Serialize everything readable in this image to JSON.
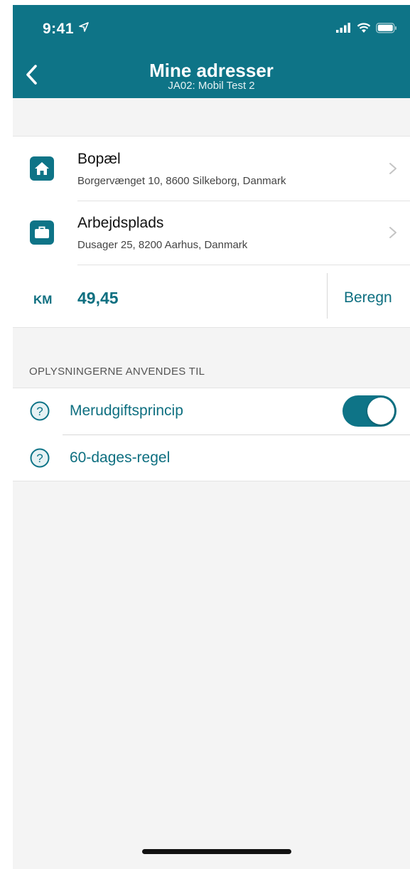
{
  "status_bar": {
    "time": "9:41"
  },
  "nav": {
    "title": "Mine adresser",
    "subtitle": "JA02: Mobil Test 2"
  },
  "addresses": [
    {
      "title": "Bopæl",
      "address": "Borgervænget 10, 8600 Silkeborg, Danmark",
      "icon": "home-icon"
    },
    {
      "title": "Arbejdsplads",
      "address": "Dusager 25, 8200 Aarhus, Danmark",
      "icon": "briefcase-icon"
    }
  ],
  "distance": {
    "unit_label": "KM",
    "value": "49,45",
    "calculate_label": "Beregn"
  },
  "section": {
    "header": "OPLYSNINGERNE ANVENDES TIL",
    "options": [
      {
        "label": "Merudgiftsprincip",
        "toggle_on": true
      },
      {
        "label": "60-dages-regel"
      }
    ]
  },
  "colors": {
    "accent": "#0e7487",
    "text_accent": "#0e6f80",
    "background": "#f4f4f4"
  }
}
